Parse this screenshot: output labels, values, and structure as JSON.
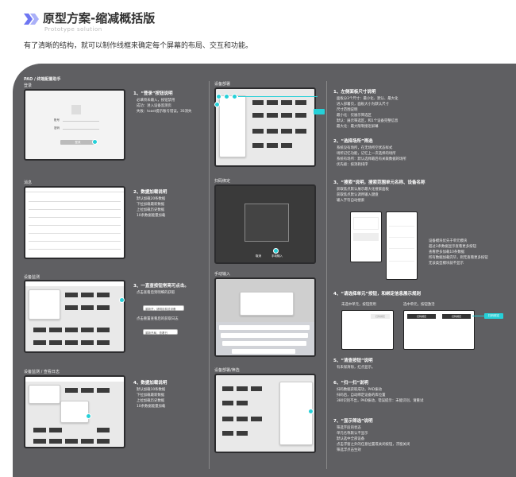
{
  "header": {
    "title": "原型方案-缩减概括版",
    "subtitle": "Prototype solution",
    "intro": "有了清晰的结构，就可以制作线框来确定每个屏幕的布局、交互和功能。"
  },
  "app": {
    "name": "PAD / 终端配置助手"
  },
  "screens": {
    "login": "登录",
    "news": "消息",
    "monitor": "设备监测",
    "monitor_log": "设备监测 / 查看日志",
    "deploy": "设备部署",
    "scan": "扫码绑定",
    "manual": "手动输入",
    "deploy_filter": "设备部署/筛选"
  },
  "login_form": {
    "field1": "账号",
    "field2": "密码",
    "button": "登录"
  },
  "sections": [
    {
      "title": "1、“登录”按钮说明",
      "items": [
        "必填项未输入，按钮禁用",
        "成功：进入设备监测页",
        "失败：toast提示账号错误，3S消失"
      ]
    },
    {
      "title": "2、数据加载说明",
      "items": [
        "默认加载20条数据",
        "下拉加载最新数据",
        "上拉加载历史数据",
        "10条数据能量加载"
      ]
    },
    {
      "title": "3、一直查按钮常亮可点击。",
      "items": [
        "点击查看后到明细的获取",
        "点击重置查看后的获取日志"
      ]
    },
    {
      "title": "4、数据加载说明",
      "items": [
        "默认加载10条数据",
        "下拉加载最新数据",
        "上拉加载历史数据",
        "10条数据能量加载"
      ]
    }
  ],
  "monitor_buttons": [
    "重新开，请明目前这设备",
    "重新开局，查看日"
  ],
  "right_sections": [
    {
      "title": "1、左侧面板尺寸说明",
      "items": [
        "面板分3个尺寸：最小化、默认、最大化",
        "进入部署页，面板大小为默认尺寸",
        "尺寸范围说明",
        "最小化：仅展示筛选区",
        "默认：展示筛选区，和1个设备完整信息",
        "最大化：最大限制接近屏幕"
      ]
    },
    {
      "title": "2、“选择场所”筛选",
      "items": [
        "系统没有场所，在无场所空状态样式",
        "场所记忆功能，记忆上一次选择的场所",
        "系统有场所：默认选择最后有关联数据的场所",
        "优先级：按消耗排序"
      ]
    },
    {
      "title": "3、“搜索”说明，搜索范围单元名称、设备名称",
      "items": [
        "获取焦点默认展示最大化搜索面板",
        "获取焦点默认调用输入键盘",
        "输入字符自动搜索"
      ]
    },
    {
      "title": "4、“请选择单元”按钮，和绑定信息展示规则",
      "items": []
    },
    {
      "title": "5、“清查按钮”说明",
      "items": [
        "有未保清除，红点显示。"
      ]
    },
    {
      "title": "6、“扫一扫”说明",
      "items": [
        "扫码数据获取成功，PAD振动",
        "扫码后，自动绑定设备的库位置",
        "380识别不出，PAD振动，错误提示：未能识别，请重试"
      ]
    },
    {
      "title": "7、“显示筛选”说明",
      "items": [
        "筛选字段的状态",
        "单元名称默认不显示",
        "默认选中全部设备",
        "点击浮窗之外的任意位置或关闭按钮，浮窗关闭",
        "筛选浮点击生效"
      ]
    }
  ],
  "side_notes": [
    "设备模块优先于单元模块",
    "超过3条数据显示查看更多按钮",
    "查看更多加载10条数据",
    "所有数据加载完毕，则无查看更多按钮",
    "无该类型模块就不显示"
  ],
  "unit_labels": {
    "unselected": "未选中单元，按钮禁用",
    "selected": "选中单元，按钮激活",
    "action": "扫码绑定",
    "tag": "扫码绑定"
  },
  "scan": {
    "cancel": "取消",
    "manual": "手动输入"
  },
  "colors": {
    "accent": "#25d0d8",
    "panel": "#5f5f62",
    "title_logo": "#6e76f2"
  }
}
